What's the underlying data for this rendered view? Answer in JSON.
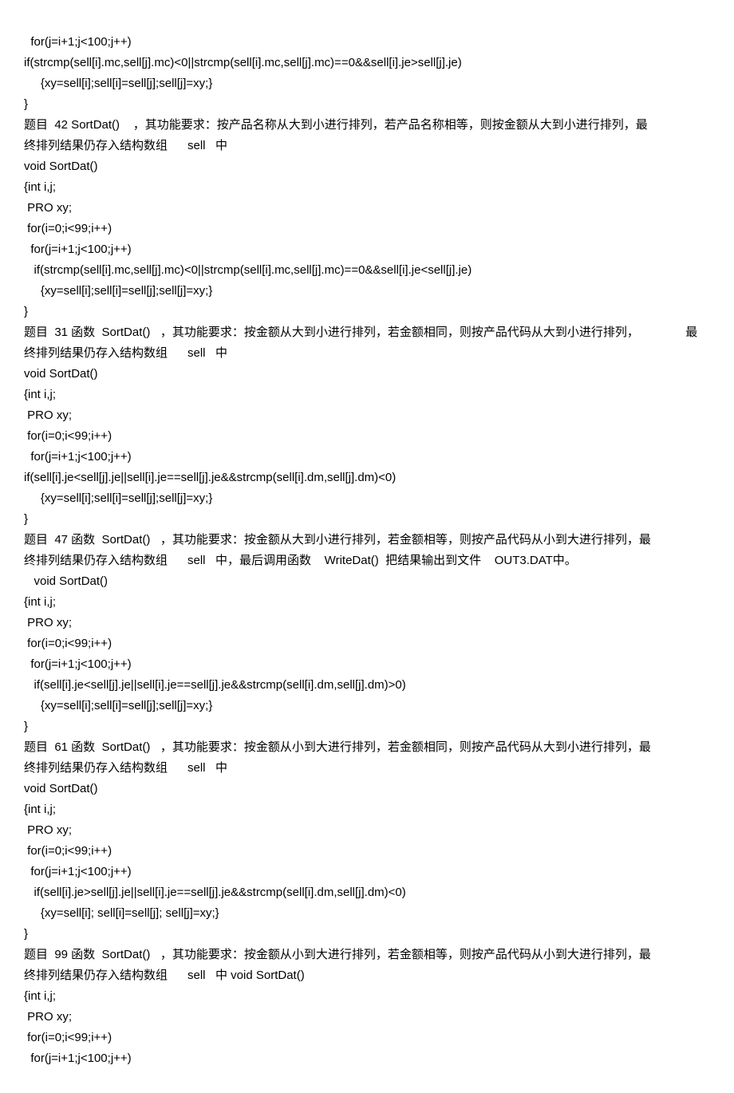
{
  "lines": [
    "  for(j=i+1;j<100;j++)",
    "if(strcmp(sell[i].mc,sell[j].mc)<0||strcmp(sell[i].mc,sell[j].mc)==0&&sell[i].je>sell[j].je)",
    "     {xy=sell[i];sell[i]=sell[j];sell[j]=xy;}",
    "}",
    "题目  42 SortDat()    ，其功能要求：按产品名称从大到小进行排列，若产品名称相等，则按金额从大到小进行排列，最",
    "终排列结果仍存入结构数组      sell   中",
    "void SortDat()",
    "{int i,j;",
    " PRO xy;",
    " for(i=0;i<99;i++)",
    "  for(j=i+1;j<100;j++)",
    "   if(strcmp(sell[i].mc,sell[j].mc)<0||strcmp(sell[i].mc,sell[j].mc)==0&&sell[i].je<sell[j].je)",
    "     {xy=sell[i];sell[i]=sell[j];sell[j]=xy;}",
    "}",
    "题目  31 函数  SortDat()   ，其功能要求：按金额从大到小进行排列，若金额相同，则按产品代码从大到小进行排列，              最",
    "终排列结果仍存入结构数组      sell   中",
    "void SortDat()",
    "{int i,j;",
    " PRO xy;",
    " for(i=0;i<99;i++)",
    "  for(j=i+1;j<100;j++)",
    "if(sell[i].je<sell[j].je||sell[i].je==sell[j].je&&strcmp(sell[i].dm,sell[j].dm)<0)",
    "     {xy=sell[i];sell[i]=sell[j];sell[j]=xy;}",
    "}",
    "题目  47 函数  SortDat()   ，其功能要求：按金额从大到小进行排列，若金额相等，则按产品代码从小到大进行排列，最",
    "终排列结果仍存入结构数组      sell   中，最后调用函数    WriteDat()  把结果输出到文件    OUT3.DAT中。",
    "   void SortDat()",
    "{int i,j;",
    " PRO xy;",
    " for(i=0;i<99;i++)",
    "  for(j=i+1;j<100;j++)",
    "   if(sell[i].je<sell[j].je||sell[i].je==sell[j].je&&strcmp(sell[i].dm,sell[j].dm)>0)",
    "     {xy=sell[i];sell[i]=sell[j];sell[j]=xy;}",
    "}",
    "题目  61 函数  SortDat()   ，其功能要求：按金额从小到大进行排列，若金额相同，则按产品代码从大到小进行排列，最",
    "终排列结果仍存入结构数组      sell   中",
    "void SortDat()",
    "{int i,j;",
    " PRO xy;",
    " for(i=0;i<99;i++)",
    "  for(j=i+1;j<100;j++)",
    "   if(sell[i].je>sell[j].je||sell[i].je==sell[j].je&&strcmp(sell[i].dm,sell[j].dm)<0)",
    "     {xy=sell[i]; sell[i]=sell[j]; sell[j]=xy;}",
    "}",
    "题目  99 函数  SortDat()   ，其功能要求：按金额从小到大进行排列，若金额相等，则按产品代码从小到大进行排列，最",
    "终排列结果仍存入结构数组      sell   中 void SortDat()",
    "{int i,j;",
    " PRO xy;",
    " for(i=0;i<99;i++)",
    "  for(j=i+1;j<100;j++)"
  ]
}
